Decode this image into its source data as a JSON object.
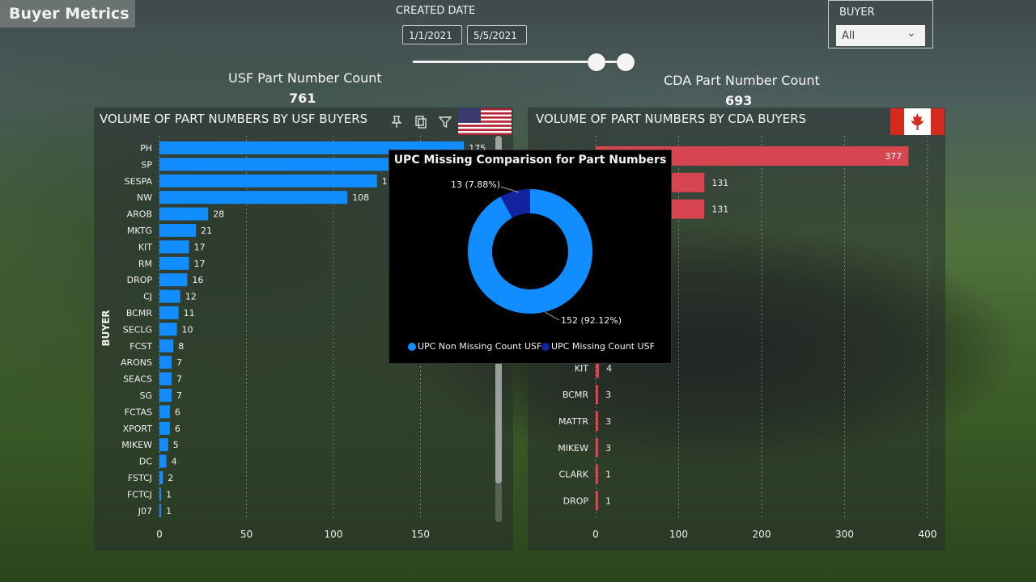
{
  "header": {
    "title": "Buyer Metrics"
  },
  "date_filter": {
    "label": "CREATED DATE",
    "start": "1/1/2021",
    "end": "5/5/2021"
  },
  "buyer_filter": {
    "label": "BUYER",
    "value": "All"
  },
  "kpis": {
    "usf": {
      "title": "USF Part Number Count",
      "value": "761"
    },
    "cda": {
      "title": "CDA Part Number Count",
      "value": "693"
    }
  },
  "popup_texts": {
    "missing_label": "13 (7.88%)",
    "nonmissing_label": "152 (92.12%)"
  },
  "colors": {
    "usf_bar": "#118dff",
    "cda_bar": "#d64550",
    "donut_main": "#118dff",
    "donut_missing": "#12239e"
  },
  "chart_data": [
    {
      "type": "bar",
      "orientation": "horizontal",
      "title": "VOLUME OF PART NUMBERS BY USF BUYERS",
      "ylabel": "BUYER",
      "categories": [
        "PH",
        "SP",
        "SESPA",
        "NW",
        "AROB",
        "MKTG",
        "KIT",
        "RM",
        "DROP",
        "CJ",
        "BCMR",
        "SECLG",
        "FCST",
        "ARONS",
        "SEACS",
        "SG",
        "FCTAS",
        "XPORT",
        "MIKEW",
        "DC",
        "FSTCJ",
        "FCTCJ",
        "J07"
      ],
      "values": [
        175,
        170,
        125,
        108,
        28,
        21,
        17,
        17,
        16,
        12,
        11,
        10,
        8,
        7,
        7,
        7,
        6,
        6,
        5,
        4,
        2,
        1,
        1
      ],
      "value_labels": [
        "175",
        "",
        "1",
        "108",
        "28",
        "21",
        "17",
        "17",
        "16",
        "12",
        "11",
        "10",
        "8",
        "7",
        "7",
        "7",
        "6",
        "6",
        "5",
        "4",
        "2",
        "1",
        "1"
      ],
      "xlim": [
        0,
        195
      ],
      "xticks": [
        "0",
        "50",
        "100",
        "150"
      ],
      "tick_values": [
        0,
        50,
        100,
        150
      ]
    },
    {
      "type": "bar",
      "orientation": "horizontal",
      "title": "VOLUME OF PART NUMBERS BY CDA BUYERS",
      "categories": [
        "",
        "",
        "",
        "",
        "",
        "",
        "",
        "",
        "KIT",
        "BCMR",
        "MATTR",
        "MIKEW",
        "CLARK",
        "DROP"
      ],
      "values": [
        377,
        131,
        131,
        null,
        null,
        null,
        null,
        null,
        4,
        3,
        3,
        3,
        1,
        1
      ],
      "value_labels": [
        "377",
        "131",
        "131",
        "",
        "",
        "",
        "",
        "",
        "4",
        "3",
        "3",
        "3",
        "1",
        "1"
      ],
      "xlim": [
        0,
        420
      ],
      "xticks": [
        "0",
        "100",
        "200",
        "300",
        "400"
      ],
      "tick_values": [
        0,
        100,
        200,
        300,
        400
      ]
    },
    {
      "type": "pie",
      "title": "UPC Missing Comparison for Part Numbers",
      "labels": [
        "UPC Non Missing Count USF",
        "UPC Missing Count USF"
      ],
      "values": [
        152,
        13
      ]
    }
  ]
}
